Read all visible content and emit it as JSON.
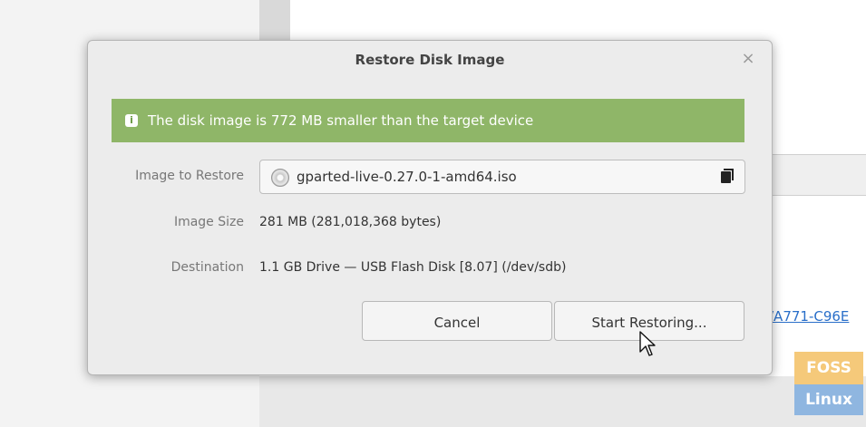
{
  "dialog": {
    "title": "Restore Disk Image",
    "close_icon": "close-icon",
    "info_message": "The disk image is 772 MB smaller than the target device",
    "info_icon": "info-icon",
    "image_to_restore_label": "Image to Restore",
    "image_file": "gparted-live-0.27.0-1-amd64.iso",
    "image_size_label": "Image Size",
    "image_size_value": "281 MB (281,018,368 bytes)",
    "destination_label": "Destination",
    "destination_value": "1.1 GB Drive — USB Flash Disk [8.07] (/dev/sdb)",
    "cancel_label": "Cancel",
    "start_label": "Start Restoring..."
  },
  "background": {
    "link_text": "/A771-C96E",
    "watermark_top": "FOSS",
    "watermark_bottom": "Linux"
  },
  "colors": {
    "info_bar": "#8fb668",
    "dialog_bg": "#ececec",
    "link": "#2a6fc9"
  }
}
